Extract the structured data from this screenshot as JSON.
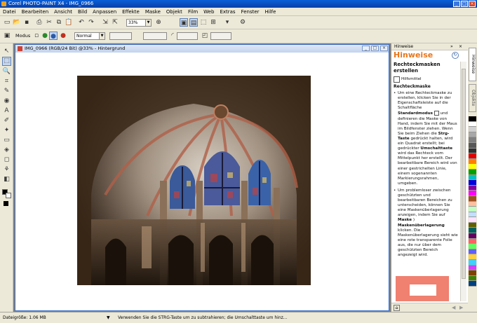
{
  "window": {
    "title": "Corel PHOTO-PAINT X4 - IMG_0966"
  },
  "menu": [
    "Datei",
    "Bearbeiten",
    "Ansicht",
    "Bild",
    "Anpassen",
    "Effekte",
    "Maske",
    "Objekt",
    "Film",
    "Web",
    "Extras",
    "Fenster",
    "Hilfe"
  ],
  "toolbar": {
    "zoom_value": "33%"
  },
  "propertybar": {
    "modus_label": "Modus",
    "merge_mode": "Normal"
  },
  "document": {
    "title": "IMG_0966 (RGB/24 Bit) @33% - Hintergrund"
  },
  "docker": {
    "header": "Hinweise",
    "title": "Hinweise",
    "heading": "Rechteckmasken erstellen",
    "hilfsmittel": "Hilfsmittel",
    "subheading": "Rechteckmaske",
    "bullet1_a": "Um eine Rechteckmaske zu erstellen, klicken Sie in der Eigenschaftsleiste auf die Schaltfläche",
    "bullet1_b": "Standardmodus",
    "bullet1_c": "und definieren die Maske von Hand, indem Sie mit der Maus im Bildfenster ziehen. Wenn Sie beim Ziehen die",
    "bullet1_d": "Strg-Taste",
    "bullet1_e": "gedrückt halten, wird ein Quadrat erstellt; bei gedrückter",
    "bullet1_f": "Umschalttaste",
    "bullet1_g": "wird das Rechteck vom Mittelpunkt her erstellt. Der bearbeitbare Bereich wird von einer gestrichelten Linie, einem sogenannten Markierungsrahmen, umgeben.",
    "bullet2_a": "Um problemloser zwischen geschützten und bearbeitbaren Bereichen zu unterscheiden, können Sie eine Maskenüberlagerung anzeigen, indem Sie auf",
    "bullet2_b": "Maske",
    "bullet2_c": "Maskenüberlagerung",
    "bullet2_d": "klicken. Die Maskenüberlagerung sieht wie eine rote transparente Folie aus, die nur über dem geschützten Bereich angezeigt wird.",
    "side_tab_1": "Hinweise",
    "side_tab_2": "Objekte"
  },
  "palette_colors": [
    "#000000",
    "#ffffff",
    "#d0d0d0",
    "#a8a8a8",
    "#808080",
    "#585858",
    "#303030",
    "#e00000",
    "#ff8000",
    "#ffff00",
    "#00a000",
    "#00c0c0",
    "#0000e0",
    "#8000a0",
    "#ff00ff",
    "#a05020",
    "#ffc0a0",
    "#c0ffc0",
    "#c0e0ff",
    "#ffe0ff",
    "#606000",
    "#006060",
    "#600060",
    "#ff6060",
    "#60ff60",
    "#6060ff",
    "#ffd040",
    "#40d0ff",
    "#d040ff",
    "#804000",
    "#408000",
    "#004080"
  ],
  "status": {
    "file_size": "Dateigröße: 1.06 MB",
    "hint": "Verwenden Sie die STRG-Taste um zu subtrahieren; die Umschalttaste um hinz..."
  }
}
